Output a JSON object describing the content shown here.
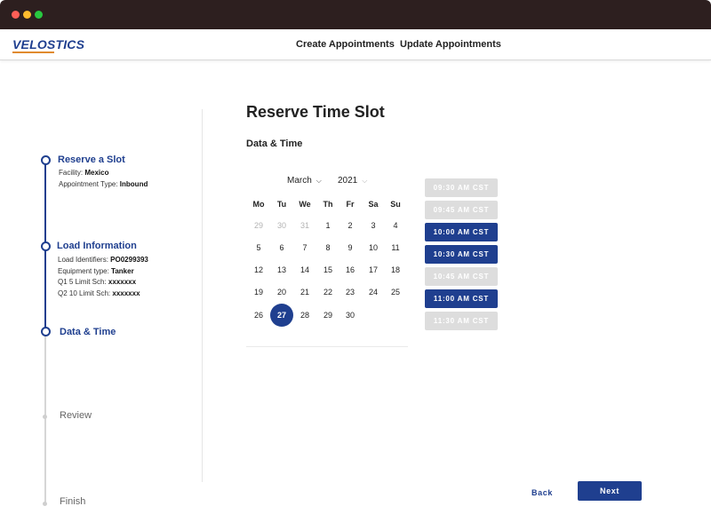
{
  "window": {
    "controls": [
      "close",
      "minimize",
      "maximize"
    ]
  },
  "header": {
    "logo": "VELOSTICS",
    "nav": [
      {
        "label": "Create Appointments"
      },
      {
        "label": "Update Appointments"
      }
    ]
  },
  "stepper": {
    "steps": [
      {
        "title": "Reserve a Slot",
        "state": "done",
        "details": [
          {
            "label": "Facility:",
            "value": "Mexico"
          },
          {
            "label": "Appointment Type:",
            "value": "Inbound"
          }
        ]
      },
      {
        "title": "Load Information",
        "state": "done",
        "details": [
          {
            "label": "Load Identifiers:",
            "value": "PO0299393"
          },
          {
            "label": "Equipment type:",
            "value": "Tanker"
          },
          {
            "label": "Q1 5 Limit Sch:",
            "value": "xxxxxxx"
          },
          {
            "label": "Q2 10 Limit Sch:",
            "value": "xxxxxxx"
          }
        ]
      },
      {
        "title": "Data & Time",
        "state": "current"
      },
      {
        "title": "Review",
        "state": "pending"
      },
      {
        "title": "Finish",
        "state": "pending"
      }
    ]
  },
  "main": {
    "title": "Reserve Time Slot",
    "section": "Data & Time",
    "calendar": {
      "month": "March",
      "year": "2021",
      "weekdays": [
        "Mo",
        "Tu",
        "We",
        "Th",
        "Fr",
        "Sa",
        "Su"
      ],
      "weeks": [
        [
          {
            "d": "29",
            "muted": true
          },
          {
            "d": "30",
            "muted": true
          },
          {
            "d": "31",
            "muted": true
          },
          {
            "d": "1"
          },
          {
            "d": "2"
          },
          {
            "d": "3"
          },
          {
            "d": "4"
          }
        ],
        [
          {
            "d": "5"
          },
          {
            "d": "6"
          },
          {
            "d": "7"
          },
          {
            "d": "8"
          },
          {
            "d": "9"
          },
          {
            "d": "10"
          },
          {
            "d": "11"
          }
        ],
        [
          {
            "d": "12"
          },
          {
            "d": "13"
          },
          {
            "d": "14"
          },
          {
            "d": "15"
          },
          {
            "d": "16"
          },
          {
            "d": "17"
          },
          {
            "d": "18"
          }
        ],
        [
          {
            "d": "19"
          },
          {
            "d": "20"
          },
          {
            "d": "21"
          },
          {
            "d": "22"
          },
          {
            "d": "23"
          },
          {
            "d": "24"
          },
          {
            "d": "25"
          }
        ],
        [
          {
            "d": "26"
          },
          {
            "d": "27",
            "selected": true
          },
          {
            "d": "28"
          },
          {
            "d": "29"
          },
          {
            "d": "30"
          }
        ]
      ]
    },
    "time_slots": [
      {
        "label": "09:30 AM CST",
        "available": false
      },
      {
        "label": "09:45 AM CST",
        "available": false
      },
      {
        "label": "10:00 AM CST",
        "available": true
      },
      {
        "label": "10:30 AM CST",
        "available": true
      },
      {
        "label": "10:45 AM CST",
        "available": false
      },
      {
        "label": "11:00 AM CST",
        "available": true
      },
      {
        "label": "11:30 AM CST",
        "available": false
      }
    ],
    "actions": {
      "back": "Back",
      "next": "Next"
    }
  },
  "colors": {
    "primary": "#1f3f8f",
    "unavailable": "#dddddd",
    "accent": "#e08a2e",
    "titlebar": "#2d1f1f"
  }
}
